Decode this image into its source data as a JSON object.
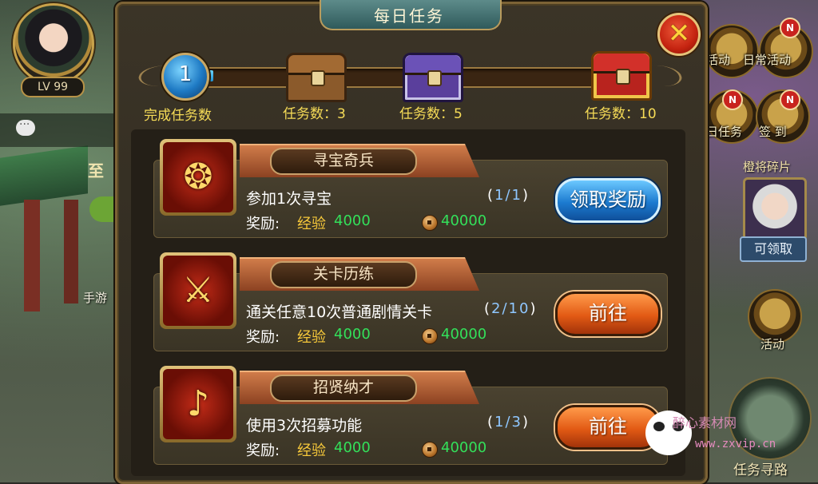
{
  "hud": {
    "level": "LV 99",
    "left_tag": "至",
    "left_tag2": "手游",
    "right_menu": [
      {
        "label": "活动",
        "icon": "activity-icon"
      },
      {
        "label": "日常活动",
        "icon": "daily-activity-icon"
      },
      {
        "label": "日任务",
        "icon": "daily-task-icon"
      },
      {
        "label": "签 到",
        "icon": "sign-in-icon"
      }
    ],
    "notification_badge": "N",
    "fragment_title": "橙将碎片",
    "fragment_claim": "可领取",
    "activity_label": "活动",
    "task_nav": "任务寻路"
  },
  "dialog": {
    "title": "每日任务",
    "close_symbol": "✕",
    "progress": {
      "completed_count": "1",
      "completed_label": "完成任务数",
      "fill_fraction": 0.02,
      "milestones": [
        {
          "label": "任务数：3",
          "chest": "wood"
        },
        {
          "label": "任务数：5",
          "chest": "purple"
        },
        {
          "label": "任务数：10",
          "chest": "gold"
        }
      ]
    },
    "reward_label": "奖励:",
    "exp_label": "经验",
    "tasks": [
      {
        "title": "寻宝奇兵",
        "description": "参加1次寻宝",
        "progress": "1/1",
        "exp": "4000",
        "coins": "40000",
        "button": "领取奖励",
        "button_style": "blue",
        "icon": "treasure-fish-icon"
      },
      {
        "title": "关卡历练",
        "description": "通关任意10次普通剧情关卡",
        "progress": "2/10",
        "exp": "4000",
        "coins": "40000",
        "button": "前往",
        "button_style": "orange",
        "icon": "crossed-swords-icon"
      },
      {
        "title": "招贤纳才",
        "description": "使用3次招募功能",
        "progress": "1/3",
        "exp": "4000",
        "coins": "40000",
        "button": "前往",
        "button_style": "orange",
        "icon": "horn-icon"
      }
    ]
  },
  "watermark": {
    "line1": "醉心素材网",
    "line2": "www.zxvip.cn"
  },
  "colors": {
    "accent_gold": "#f6dc57",
    "progress_blue": "#8fc7ff",
    "value_green": "#33e05a",
    "exp_gold": "#f6c83a"
  }
}
